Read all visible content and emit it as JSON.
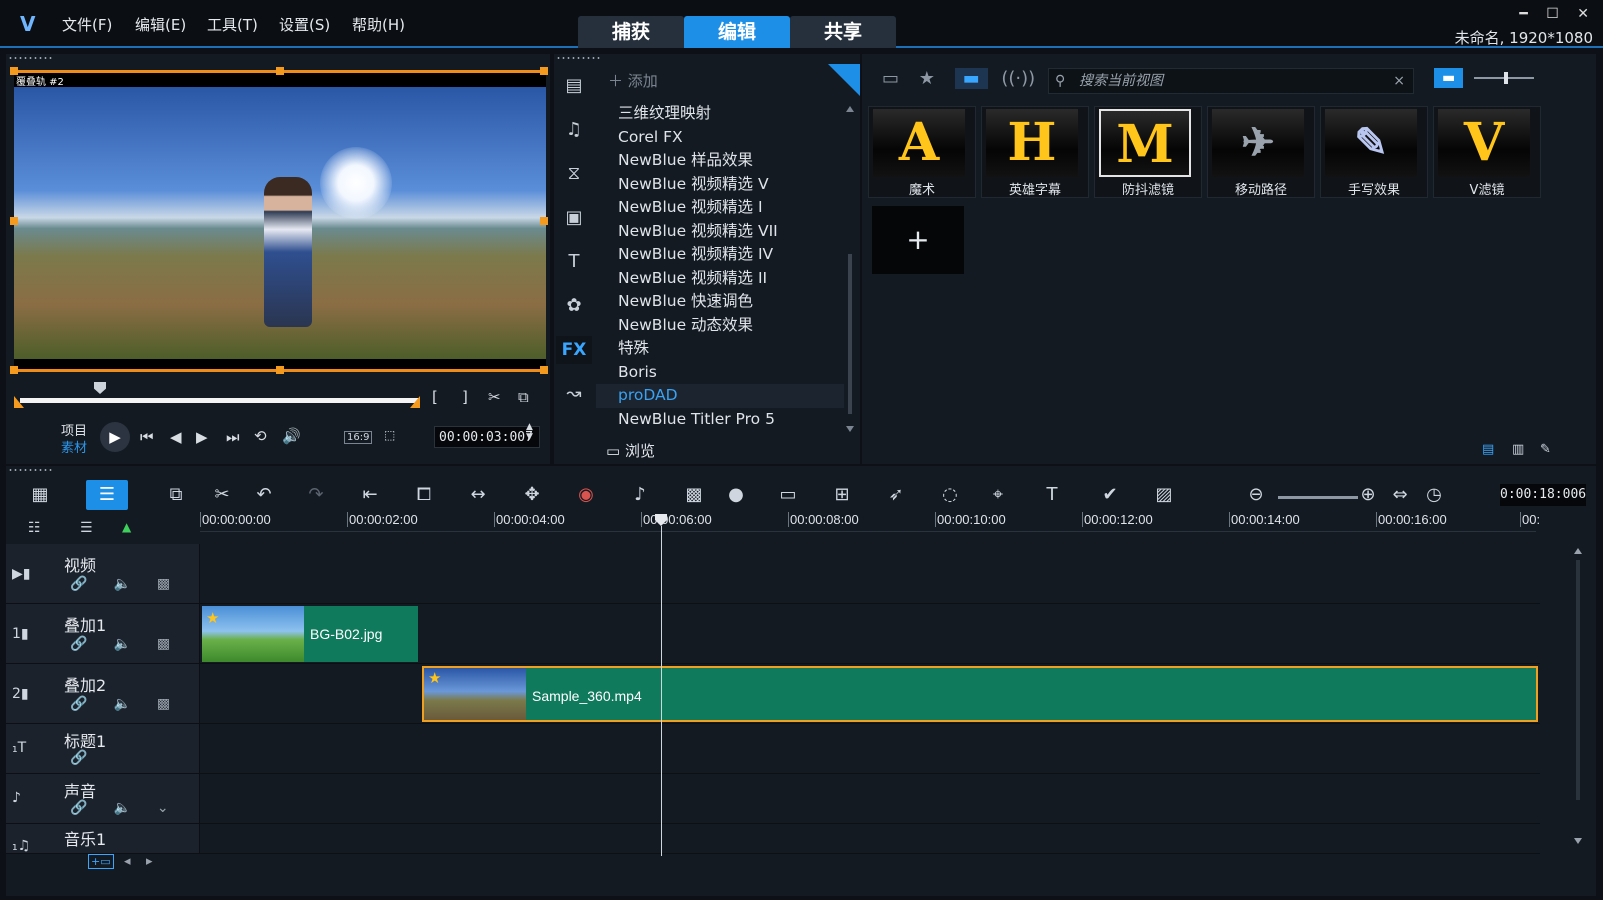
{
  "titlebar": {
    "menu": [
      "文件(F)",
      "编辑(E)",
      "工具(T)",
      "设置(S)",
      "帮助(H)"
    ],
    "modes": [
      "捕获",
      "编辑",
      "共享"
    ],
    "active_mode": "编辑",
    "project_info": "未命名, 1920*1080",
    "window_controls": [
      "minimize-icon",
      "maximize-icon",
      "close-icon"
    ]
  },
  "preview": {
    "clip_label": "覆叠轨 #2",
    "mode_project": "项目",
    "mode_clip": "素材",
    "timecode": "00:00:03:007",
    "aspect_ratio": "16:9",
    "trim_start_label": "[",
    "trim_end_label": "]",
    "scrubber_position": 0.2
  },
  "library": {
    "add_label": "添加",
    "browse_label": "浏览",
    "sidebar_icons": [
      "media-icon",
      "instant-project-icon",
      "transition-icon",
      "title-icon",
      "text-icon",
      "graphics-icon",
      "fx-icon",
      "path-icon"
    ],
    "categories": [
      "三维纹理映射",
      "Corel FX",
      "NewBlue 样品效果",
      "NewBlue 视频精选 V",
      "NewBlue 视频精选 I",
      "NewBlue 视频精选 VII",
      "NewBlue 视频精选 IV",
      "NewBlue 视频精选 II",
      "NewBlue 快速调色",
      "NewBlue 动态效果",
      "特殊",
      "Boris",
      "proDAD",
      "NewBlue Titler Pro 5"
    ],
    "selected_category": "proDAD"
  },
  "effects": {
    "search_placeholder": "搜索当前视图",
    "items": [
      {
        "name": "魔术",
        "glyph": "A"
      },
      {
        "name": "英雄字幕",
        "glyph": "H"
      },
      {
        "name": "防抖滤镜",
        "glyph": "M"
      },
      {
        "name": "移动路径",
        "glyph": "✈"
      },
      {
        "name": "手写效果",
        "glyph": "✎"
      },
      {
        "name": "V滤镜",
        "glyph": "V"
      }
    ],
    "selected_item": "防抖滤镜",
    "add_glyph": "+"
  },
  "timeline": {
    "duration": "0:00:18:006",
    "ruler": [
      "00:00:00:00",
      "00:00:02:00",
      "00:00:04:00",
      "00:00:06:00",
      "00:00:08:00",
      "00:00:10:00",
      "00:00:12:00",
      "00:00:14:00",
      "00:00:16:00",
      "00:"
    ],
    "tracks": [
      {
        "name": "视频",
        "icon": "video-track-icon"
      },
      {
        "name": "叠加1",
        "icon": "overlay1-track-icon"
      },
      {
        "name": "叠加2",
        "icon": "overlay2-track-icon"
      },
      {
        "name": "标题1",
        "icon": "title-track-icon"
      },
      {
        "name": "声音",
        "icon": "voice-track-icon"
      },
      {
        "name": "音乐1",
        "icon": "music-track-icon"
      }
    ],
    "clips": [
      {
        "track": "叠加1",
        "name": "BG-B02.jpg"
      },
      {
        "track": "叠加2",
        "name": "Sample_360.mp4"
      }
    ],
    "playhead_time": "00:00:06:00"
  }
}
